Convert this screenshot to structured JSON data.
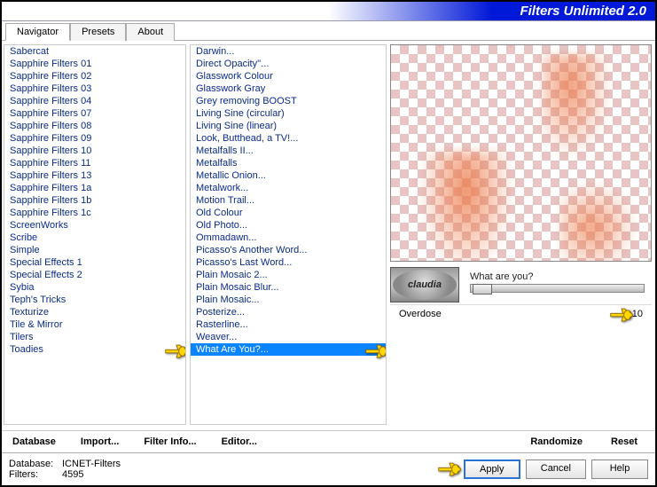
{
  "title": "Filters Unlimited 2.0",
  "tabs": [
    "Navigator",
    "Presets",
    "About"
  ],
  "activeTab": 0,
  "categories": [
    "Sabercat",
    "Sapphire Filters 01",
    "Sapphire Filters 02",
    "Sapphire Filters 03",
    "Sapphire Filters 04",
    "Sapphire Filters 07",
    "Sapphire Filters 08",
    "Sapphire Filters 09",
    "Sapphire Filters 10",
    "Sapphire Filters 11",
    "Sapphire Filters 13",
    "Sapphire Filters 1a",
    "Sapphire Filters 1b",
    "Sapphire Filters 1c",
    "ScreenWorks",
    "Scribe",
    "Simple",
    "Special Effects 1",
    "Special Effects 2",
    "Sybia",
    "Teph's Tricks",
    "Texturize",
    "Tile & Mirror",
    "Tilers",
    "Toadies"
  ],
  "selectedCategory": "Toadies",
  "filters": [
    "Darwin...",
    "Direct Opacity''...",
    "Glasswork Colour",
    "Glasswork Gray",
    "Grey removing BOOST",
    "Living Sine (circular)",
    "Living Sine (linear)",
    "Look, Butthead, a TV!...",
    "Metalfalls II...",
    "Metalfalls",
    "Metallic Onion...",
    "Metalwork...",
    "Motion Trail...",
    "Old Colour",
    "Old Photo...",
    "Ommadawn...",
    "Picasso's Another Word...",
    "Picasso's Last Word...",
    "Plain Mosaic 2...",
    "Plain Mosaic Blur...",
    "Plain Mosaic...",
    "Posterize...",
    "Rasterline...",
    "Weaver...",
    "What Are You?..."
  ],
  "selectedFilter": "What Are You?...",
  "watermark": "claudia",
  "filterTitle": "What are you?",
  "param": {
    "label": "Overdose",
    "value": "10"
  },
  "toolbar1": {
    "database": "Database",
    "import": "Import...",
    "filterinfo": "Filter Info...",
    "editor": "Editor..."
  },
  "toolbar2": {
    "randomize": "Randomize",
    "reset": "Reset"
  },
  "footer": {
    "dbLabel": "Database:",
    "dbValue": "ICNET-Filters",
    "filtersLabel": "Filters:",
    "filtersValue": "4595"
  },
  "buttons": {
    "apply": "Apply",
    "cancel": "Cancel",
    "help": "Help"
  }
}
